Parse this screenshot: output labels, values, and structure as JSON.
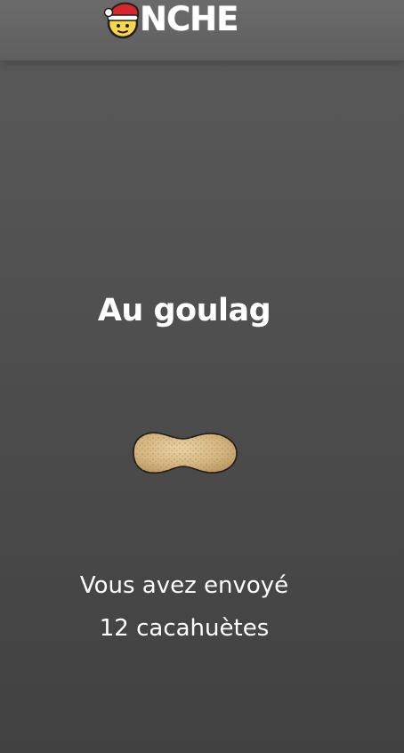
{
  "header": {
    "logo_text": "NCHE",
    "logo_icon": "santa-face-icon"
  },
  "main": {
    "title": "Au goulag",
    "peanut_icon": "peanut-icon",
    "message_line1": "Vous avez envoyé",
    "message_line2": "12 cacahuètes"
  },
  "colors": {
    "background_top": "#5b5b5b",
    "background_bottom": "#414141",
    "header": "#666666",
    "text": "#ffffff",
    "santa_hat": "#d7262c",
    "face": "#fbd64a"
  }
}
